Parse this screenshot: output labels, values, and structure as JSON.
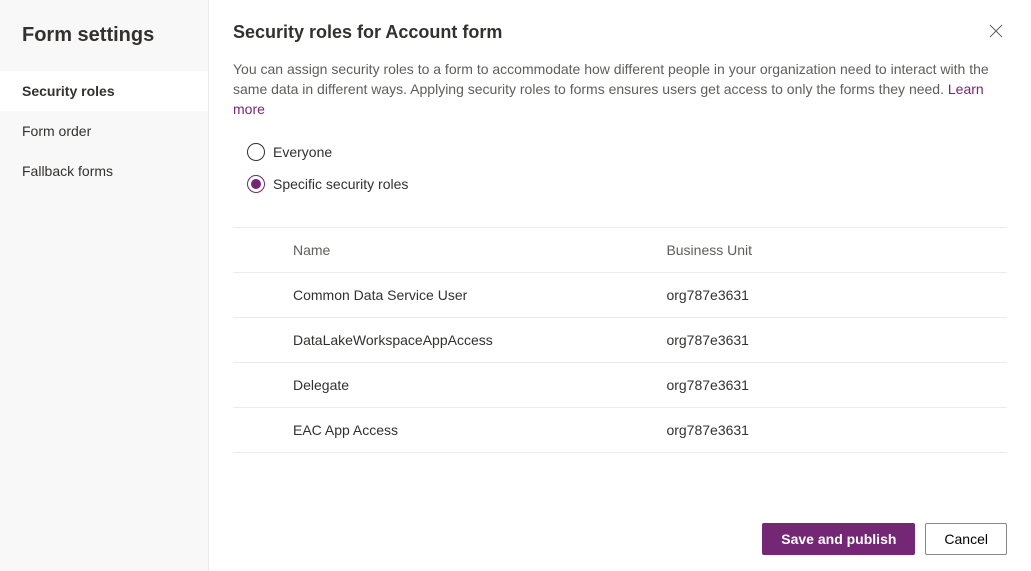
{
  "sidebar": {
    "title": "Form settings",
    "items": [
      {
        "label": "Security roles",
        "active": true
      },
      {
        "label": "Form order",
        "active": false
      },
      {
        "label": "Fallback forms",
        "active": false
      }
    ]
  },
  "main": {
    "title": "Security roles for Account form",
    "description": "You can assign security roles to a form to accommodate how different people in your organization need to interact with the same data in different ways. Applying security roles to forms ensures users get access to only the forms they need. ",
    "learn_more": "Learn more"
  },
  "radio": {
    "everyone": "Everyone",
    "specific": "Specific security roles",
    "selected": "specific"
  },
  "table": {
    "headers": {
      "name": "Name",
      "business_unit": "Business Unit"
    },
    "rows": [
      {
        "name": "Common Data Service User",
        "business_unit": "org787e3631"
      },
      {
        "name": "DataLakeWorkspaceAppAccess",
        "business_unit": "org787e3631"
      },
      {
        "name": "Delegate",
        "business_unit": "org787e3631"
      },
      {
        "name": "EAC App Access",
        "business_unit": "org787e3631"
      }
    ]
  },
  "footer": {
    "save": "Save and publish",
    "cancel": "Cancel"
  }
}
